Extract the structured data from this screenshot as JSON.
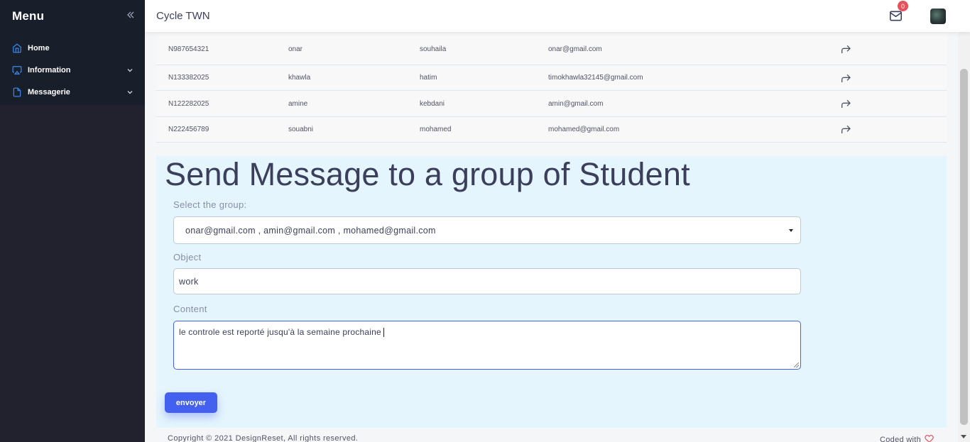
{
  "sidebar": {
    "title": "Menu",
    "items": [
      {
        "label": "Home",
        "icon": "home-icon"
      },
      {
        "label": "Information",
        "icon": "airplay-icon"
      },
      {
        "label": "Messagerie",
        "icon": "file-icon"
      }
    ]
  },
  "header": {
    "title": "Cycle TWN",
    "mail_badge": "0"
  },
  "table": {
    "rows": [
      [
        "N987654321",
        "onar",
        "souhaila",
        "onar@gmail.com"
      ],
      [
        "N133382025",
        "khawla",
        "hatim",
        "timokhawla32145@gmail.com"
      ],
      [
        "N122282025",
        "amine",
        "kebdani",
        "amin@gmail.com"
      ],
      [
        "N222456789",
        "souabni",
        "mohamed",
        "mohamed@gmail.com"
      ]
    ]
  },
  "form": {
    "title": "Send Message to a group of Student",
    "group_label": "Select the group:",
    "group_value": "onar@gmail.com , amin@gmail.com , mohamed@gmail.com",
    "object_label": "Object",
    "object_value": "work",
    "content_label": "Content",
    "content_value": "le controle est reporté jusqu'à la semaine prochaine",
    "submit_label": "envoyer"
  },
  "footer": {
    "copyright": "Copyright © 2021 DesignReset, All rights reserved.",
    "coded_with": "Coded with"
  },
  "colors": {
    "sidebar_bg": "#22222f",
    "accent": "#4361ee",
    "badge": "#e7515a",
    "panel_bg": "#e5f5fd"
  }
}
